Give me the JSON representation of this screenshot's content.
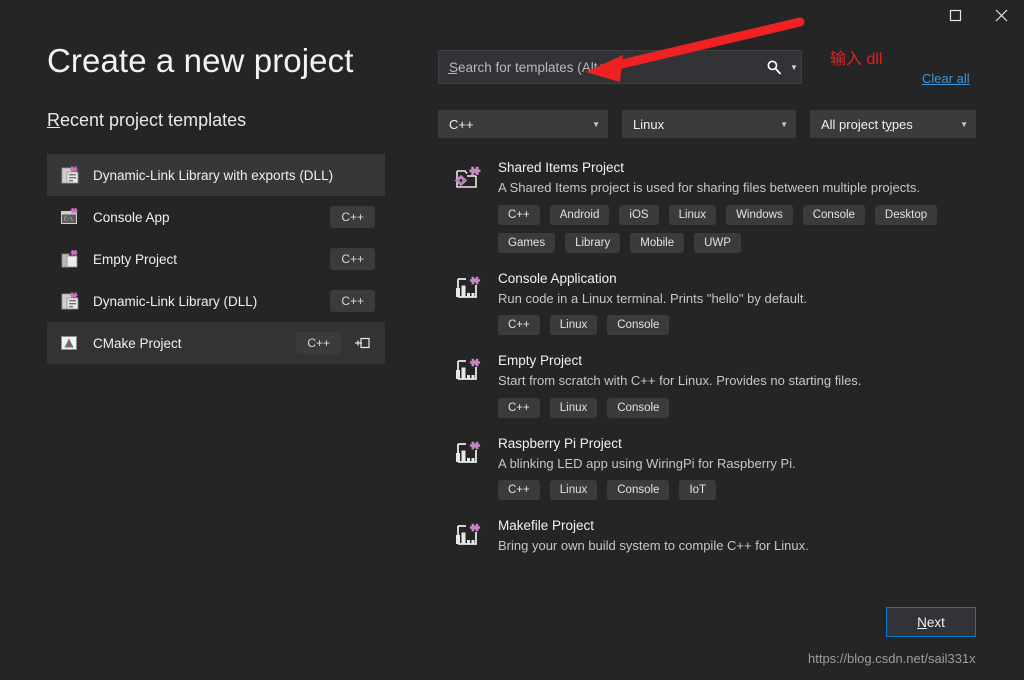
{
  "window": {
    "maximize_icon": "maximize-icon",
    "close_icon": "close-icon"
  },
  "left": {
    "title": "Create a new project",
    "recent_header_accel": "R",
    "recent_header_rest": "ecent project templates",
    "recent_items": [
      {
        "label": "Dynamic-Link Library with exports (DLL)",
        "badge": "",
        "icon": "dll-project-icon",
        "state": "selected",
        "pinned": false
      },
      {
        "label": "Console App",
        "badge": "C++",
        "icon": "console-app-icon",
        "state": "normal",
        "pinned": false
      },
      {
        "label": "Empty Project",
        "badge": "C++",
        "icon": "empty-project-icon",
        "state": "normal",
        "pinned": false
      },
      {
        "label": "Dynamic-Link Library (DLL)",
        "badge": "C++",
        "icon": "dll-project-icon",
        "state": "normal",
        "pinned": false
      },
      {
        "label": "CMake Project",
        "badge": "C++",
        "icon": "cmake-project-icon",
        "state": "hover",
        "pinned": true
      }
    ]
  },
  "search": {
    "value": "",
    "placeholder": "Search for templates (Alt+S)",
    "magnifier_icon": "search-icon",
    "caret_icon": "chevron-down-icon"
  },
  "annotation": {
    "text": "输入 dll",
    "color": "#e02222",
    "arrow_color": "#ee2222"
  },
  "clear_all": "Clear all",
  "filters": [
    {
      "name": "language-filter",
      "value": "C++",
      "accel": ""
    },
    {
      "name": "platform-filter",
      "value": "Linux",
      "accel": ""
    },
    {
      "name": "project-type-filter",
      "value": "All project t",
      "accel": "y",
      "suffix": "pes"
    }
  ],
  "templates": [
    {
      "title": "Shared Items Project",
      "description": "A Shared Items project is used for sharing files between multiple projects.",
      "icon": "shared-items-icon",
      "tags": [
        "C++",
        "Android",
        "iOS",
        "Linux",
        "Windows",
        "Console",
        "Desktop",
        "Games",
        "Library",
        "Mobile",
        "UWP"
      ]
    },
    {
      "title": "Console Application",
      "description": "Run code in a Linux terminal. Prints \"hello\" by default.",
      "icon": "console-application-icon",
      "tags": [
        "C++",
        "Linux",
        "Console"
      ]
    },
    {
      "title": "Empty Project",
      "description": "Start from scratch with C++ for Linux. Provides no starting files.",
      "icon": "console-application-icon",
      "tags": [
        "C++",
        "Linux",
        "Console"
      ]
    },
    {
      "title": "Raspberry Pi Project",
      "description": "A blinking LED app using WiringPi for Raspberry Pi.",
      "icon": "console-application-icon",
      "tags": [
        "C++",
        "Linux",
        "Console",
        "IoT"
      ]
    },
    {
      "title": "Makefile Project",
      "description": "Bring your own build system to compile C++ for Linux.",
      "icon": "console-application-icon",
      "tags": []
    }
  ],
  "next_button": {
    "accel": "N",
    "rest": "ext"
  },
  "watermark": "https://blog.csdn.net/sail331x",
  "colors": {
    "background": "#252526",
    "panel": "#333337",
    "selected_row": "#37373a",
    "accent_blue": "#007acc",
    "link_blue": "#3a96dd",
    "tag_bg": "#3b3b3e",
    "icon_purple": "#c586c0"
  }
}
